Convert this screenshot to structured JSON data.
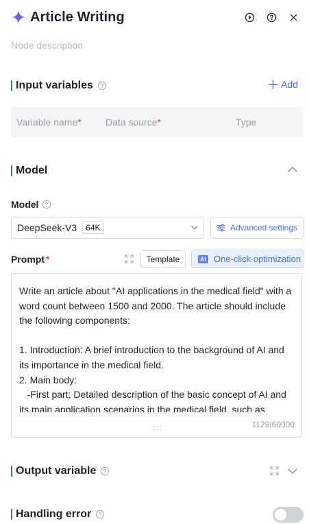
{
  "header": {
    "title": "Article Writing",
    "icons": [
      "sparkle-icon",
      "run-icon",
      "help-icon",
      "close-icon"
    ]
  },
  "description": {
    "placeholder": "Node description"
  },
  "input_variables": {
    "title": "Input variables",
    "add_label": "Add",
    "columns": {
      "name": "Variable name",
      "source": "Data source",
      "type": "Type",
      "required_mark": "*"
    }
  },
  "model_section": {
    "title": "Model",
    "field_label": "Model",
    "selected_model": "DeepSeek-V3",
    "context_badge": "64K",
    "advanced_label": "Advanced settings"
  },
  "prompt": {
    "label": "Prompt",
    "required_mark": "*",
    "template_label": "Template",
    "ai_badge": "AI",
    "optimize_label": "One-click optimization",
    "text": "Write an article about \"AI applications in the medical field\" with a word count between 1500 and 2000. The article should include the following components:\n\n1. Introduction: A brief introduction to the background of AI and its importance in the medical field.\n2. Main body:\n   -First part: Detailed description of the basic concept of AI and its main application scenarios in the medical field, such as",
    "char_count": "1129/60000"
  },
  "output_variable": {
    "title": "Output variable"
  },
  "handling_error": {
    "title": "Handling error",
    "enabled": false
  },
  "colors": {
    "accent": "#4070f4",
    "section_bar": "#3a67f5",
    "sparkle": "#7b5cf5",
    "required": "#f04848",
    "toggle_off": "#cfd2d7"
  }
}
